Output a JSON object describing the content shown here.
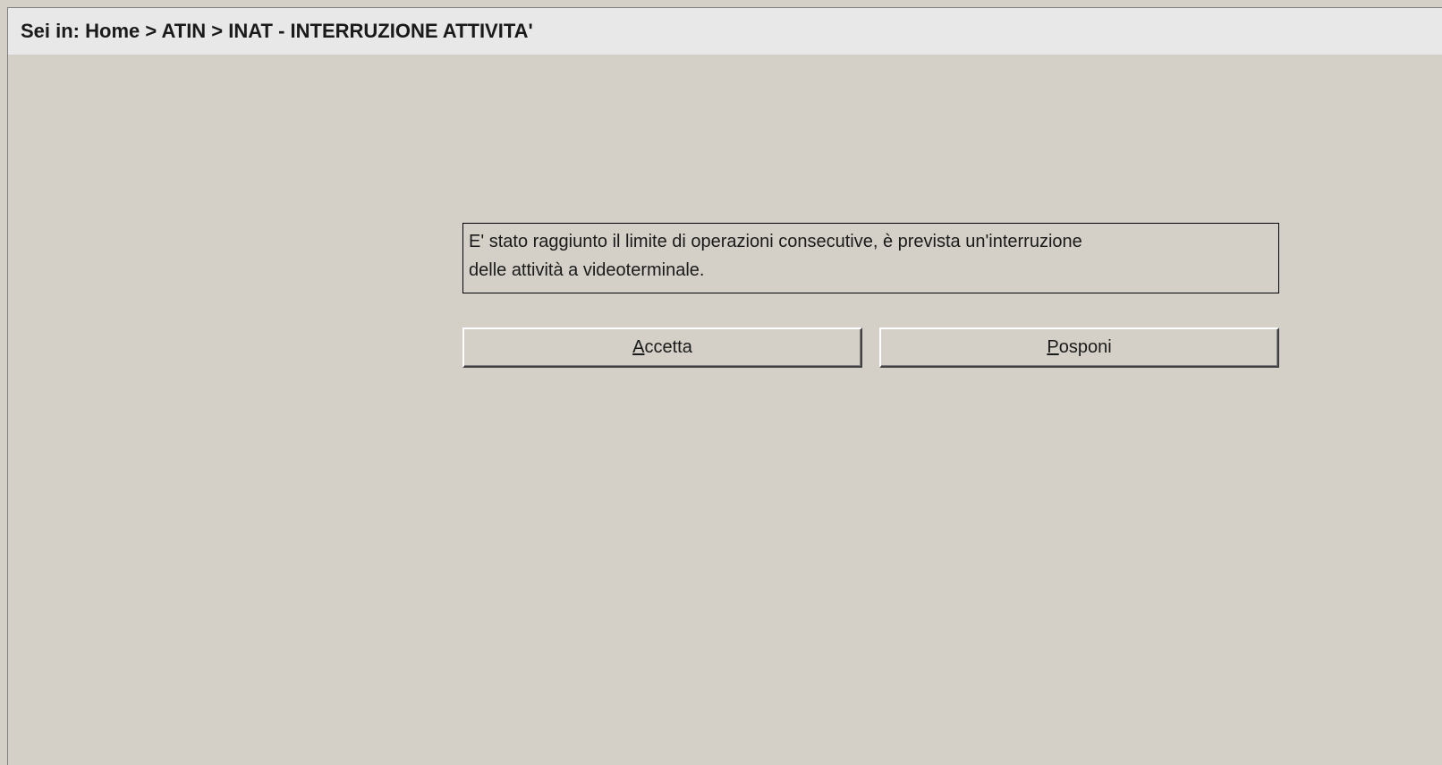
{
  "breadcrumb": {
    "text": "Sei in: Home > ATIN > INAT - INTERRUZIONE ATTIVITA'"
  },
  "message": {
    "line1": "E' stato raggiunto il limite di operazioni consecutive, è prevista un'interruzione",
    "line2": "delle attività a videoterminale."
  },
  "buttons": {
    "accept": {
      "first": "A",
      "rest": "ccetta"
    },
    "postpone": {
      "first": "P",
      "rest": "osponi"
    }
  },
  "colors": {
    "background": "#d4d0c8",
    "header": "#e8e8e8"
  }
}
